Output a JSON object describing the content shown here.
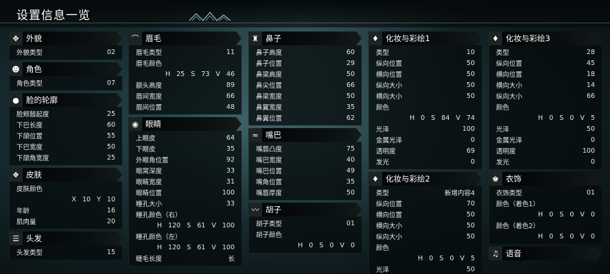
{
  "page_title": "设置信息一览",
  "columns": [
    [
      {
        "icon": "diamond-grid-icon",
        "title": "外貌",
        "rows": [
          {
            "l": "外貌类型",
            "v": "02"
          }
        ]
      },
      {
        "icon": "face-icon",
        "title": "角色",
        "rows": [
          {
            "l": "角色类型",
            "v": "07"
          }
        ]
      },
      {
        "icon": "head-icon",
        "title": "脸的轮廓",
        "rows": [
          {
            "l": "脸颊鼓起度",
            "v": "25"
          },
          {
            "l": "下巴长度",
            "v": "60"
          },
          {
            "l": "下颌位置",
            "v": "55"
          },
          {
            "l": "下巴宽度",
            "v": "50"
          },
          {
            "l": "下颌角宽度",
            "v": "25"
          }
        ]
      },
      {
        "icon": "skin-icon",
        "title": "皮肤",
        "rows": [
          {
            "l": "皮肤颜色",
            "v": ""
          },
          {
            "r": "X 10 Y 10"
          },
          {
            "l": "年龄",
            "v": "16"
          },
          {
            "l": "肌肉量",
            "v": "20"
          }
        ]
      },
      {
        "icon": "hair-icon",
        "title": "头发",
        "rows": [
          {
            "l": "头发类型",
            "v": "15"
          }
        ]
      }
    ],
    [
      {
        "icon": "eyebrow-icon",
        "title": "眉毛",
        "rows": [
          {
            "l": "眉毛类型",
            "v": "11"
          },
          {
            "l": "眉毛颜色",
            "v": ""
          },
          {
            "r": "H 25 S 73 V 46"
          },
          {
            "l": "额头高度",
            "v": "89"
          },
          {
            "l": "眉间宽度",
            "v": "66"
          },
          {
            "l": "眉间位置",
            "v": "48"
          }
        ]
      },
      {
        "icon": "eye-icon",
        "title": "眼睛",
        "rows": [
          {
            "l": "上眼皮",
            "v": "64"
          },
          {
            "l": "下眼皮",
            "v": "35"
          },
          {
            "l": "外眼角位置",
            "v": "92"
          },
          {
            "l": "眼窝深度",
            "v": "33"
          },
          {
            "l": "眼睛宽度",
            "v": "31"
          },
          {
            "l": "眼睛位置",
            "v": "100"
          },
          {
            "l": "瞳孔大小",
            "v": "33"
          },
          {
            "l": "瞳孔颜色（右）",
            "v": ""
          },
          {
            "r": "H 120 S 61 V 100"
          },
          {
            "l": "瞳孔颜色（左）",
            "v": ""
          },
          {
            "r": "H 120 S 61 V 100"
          },
          {
            "l": "睫毛长度",
            "v": "长"
          }
        ]
      }
    ],
    [
      {
        "icon": "nose-icon",
        "title": "鼻子",
        "rows": [
          {
            "l": "鼻子高度",
            "v": "60"
          },
          {
            "l": "鼻子位置",
            "v": "29"
          },
          {
            "l": "鼻梁高度",
            "v": "50"
          },
          {
            "l": "鼻尖位置",
            "v": "66"
          },
          {
            "l": "鼻梁宽度",
            "v": "50"
          },
          {
            "l": "鼻翼宽度",
            "v": "35"
          },
          {
            "l": "鼻翼位置",
            "v": "62"
          }
        ]
      },
      {
        "icon": "mouth-icon",
        "title": "嘴巴",
        "rows": [
          {
            "l": "嘴唇凸度",
            "v": "75"
          },
          {
            "l": "嘴巴宽度",
            "v": "40"
          },
          {
            "l": "嘴巴位置",
            "v": "49"
          },
          {
            "l": "嘴角位置",
            "v": "35"
          },
          {
            "l": "嘴唇厚度",
            "v": "50"
          }
        ]
      },
      {
        "icon": "mustache-icon",
        "title": "胡子",
        "rows": [
          {
            "l": "胡子类型",
            "v": "01"
          },
          {
            "l": "胡子颜色",
            "v": ""
          },
          {
            "r": "H 0 S 0 V 0"
          }
        ]
      }
    ],
    [
      {
        "icon": "makeup-icon",
        "title": "化妆与彩绘1",
        "rows": [
          {
            "l": "类型",
            "v": "10"
          },
          {
            "l": "纵向位置",
            "v": "50"
          },
          {
            "l": "横向位置",
            "v": "50"
          },
          {
            "l": "纵向大小",
            "v": "50"
          },
          {
            "l": "横向大小",
            "v": "50"
          },
          {
            "l": "颜色",
            "v": ""
          },
          {
            "r": "H 0 S 84 V 74"
          },
          {
            "l": "光泽",
            "v": "100"
          },
          {
            "l": "金属光泽",
            "v": "0"
          },
          {
            "l": "透明度",
            "v": "69"
          },
          {
            "l": "发光",
            "v": "0"
          }
        ]
      },
      {
        "icon": "makeup-icon",
        "title": "化妆与彩绘2",
        "rows": [
          {
            "l": "类型",
            "v": "新增内容4"
          },
          {
            "l": "纵向位置",
            "v": "70"
          },
          {
            "l": "横向位置",
            "v": "50"
          },
          {
            "l": "横向大小",
            "v": "50"
          },
          {
            "l": "纵向大小",
            "v": "50"
          },
          {
            "l": "颜色",
            "v": ""
          },
          {
            "r": "H 0 S 0 V 5"
          },
          {
            "l": "光泽",
            "v": "50"
          }
        ]
      }
    ],
    [
      {
        "icon": "makeup-icon",
        "title": "化妆与彩绘3",
        "rows": [
          {
            "l": "类型",
            "v": "28"
          },
          {
            "l": "纵向位置",
            "v": "45"
          },
          {
            "l": "横向位置",
            "v": "18"
          },
          {
            "l": "横向大小",
            "v": "14"
          },
          {
            "l": "纵向大小",
            "v": "66"
          },
          {
            "l": "颜色",
            "v": ""
          },
          {
            "r": "H 0 S 0 V 5"
          },
          {
            "l": "光泽",
            "v": "50"
          },
          {
            "l": "金属光泽",
            "v": "0"
          },
          {
            "l": "透明度",
            "v": "100"
          },
          {
            "l": "发光",
            "v": "0"
          }
        ]
      },
      {
        "icon": "costume-icon",
        "title": "衣饰",
        "rows": [
          {
            "l": "衣饰类型",
            "v": "01"
          },
          {
            "l": "颜色（着色1）",
            "v": ""
          },
          {
            "r": "H 0 S 0 V 0"
          },
          {
            "l": "颜色（着色2）",
            "v": ""
          },
          {
            "r": "H 0 S 0 V 0"
          }
        ]
      },
      {
        "icon": "voice-icon",
        "title": "语音",
        "rows": []
      }
    ]
  ]
}
